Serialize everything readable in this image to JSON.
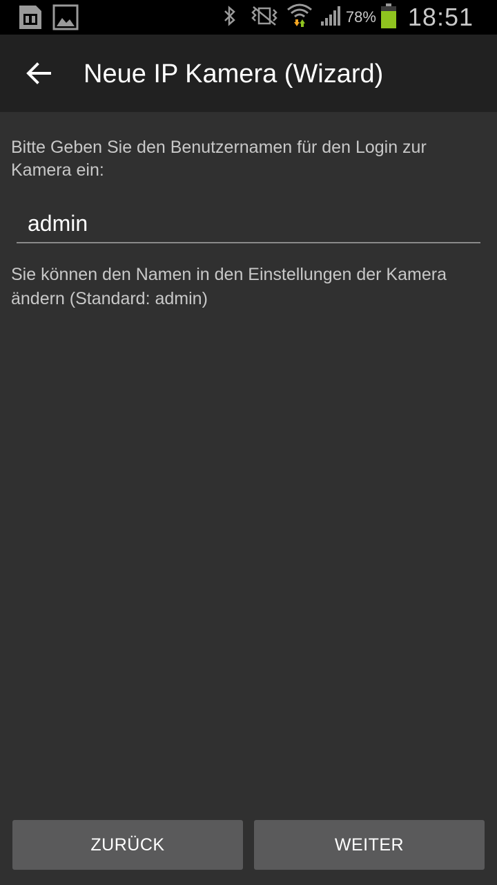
{
  "statusbar": {
    "left_icons": [
      "sim-card-icon",
      "image-icon"
    ],
    "right_icons": [
      "bluetooth-icon",
      "vibrate-icon",
      "wifi-icon",
      "signal-icon",
      "battery-icon"
    ],
    "battery_percent": "78%",
    "battery_level": 0.78,
    "time": "18:51"
  },
  "toolbar": {
    "back_icon": "arrow-left-icon",
    "title": "Neue IP Kamera (Wizard)"
  },
  "content": {
    "prompt": "Bitte Geben Sie den Benutzernamen für den Login zur Kamera ein:",
    "username_value": "admin",
    "hint": "Sie können den Namen in den Einstellungen der Kamera ändern (Standard: admin)"
  },
  "buttons": {
    "back_label": "ZURÜCK",
    "next_label": "WEITER"
  },
  "colors": {
    "background": "#303030",
    "toolbar": "#212121",
    "button": "#5a5a5b",
    "battery_fill": "#8fc31f",
    "wifi_up": "#8fc31f",
    "wifi_down": "#f5a623"
  }
}
